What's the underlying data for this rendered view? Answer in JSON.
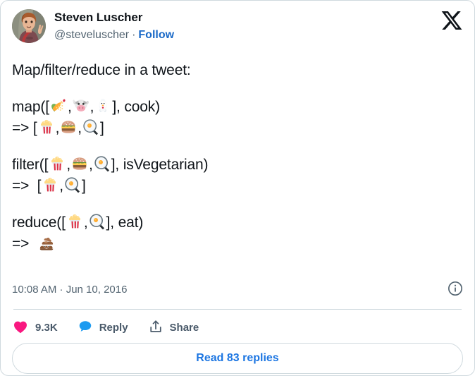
{
  "card": {
    "border_color": "#cfd9de",
    "background": "#ffffff"
  },
  "header": {
    "display_name": "Steven Luscher",
    "handle": "@steveluscher",
    "separator": "·",
    "follow_label": "Follow",
    "follow_color": "#1a69c7",
    "avatar_alt": "avatar",
    "platform_logo": "x-logo"
  },
  "tweet": {
    "line_intro": "Map/filter/reduce in a tweet:",
    "blocks": [
      {
        "call_prefix": "map([",
        "input_emojis": [
          "corn",
          "cow-face",
          "chicken"
        ],
        "call_suffix": "], cook)",
        "arrow": "=>",
        "result_open": "[",
        "result_emojis": [
          "popcorn",
          "hamburger",
          "fried-egg"
        ],
        "result_close": "]"
      },
      {
        "call_prefix": "filter([",
        "input_emojis": [
          "popcorn",
          "hamburger",
          "fried-egg"
        ],
        "call_suffix": "], isVegetarian)",
        "arrow": "=>",
        "result_open": "[",
        "result_emojis": [
          "popcorn",
          "fried-egg"
        ],
        "result_close": "]"
      },
      {
        "call_prefix": "reduce([",
        "input_emojis": [
          "popcorn",
          "fried-egg"
        ],
        "call_suffix": "], eat)",
        "arrow": "=>",
        "result_open": "",
        "result_emojis": [
          "pile-of-poo"
        ],
        "result_close": ""
      }
    ],
    "comma": ","
  },
  "meta": {
    "timestamp": "10:08 AM · Jun 10, 2016",
    "info_icon": "info-circle-icon"
  },
  "actions": {
    "like": {
      "icon": "heart-icon",
      "label": "9.3K",
      "color": "#f91880"
    },
    "reply": {
      "icon": "speech-bubble-icon",
      "label": "Reply",
      "color": "#1d9bf0"
    },
    "share": {
      "icon": "share-icon",
      "label": "Share",
      "color": "#4a5a6a"
    }
  },
  "footer": {
    "read_replies_label": "Read 83 replies",
    "link_color": "#1d76e2"
  }
}
